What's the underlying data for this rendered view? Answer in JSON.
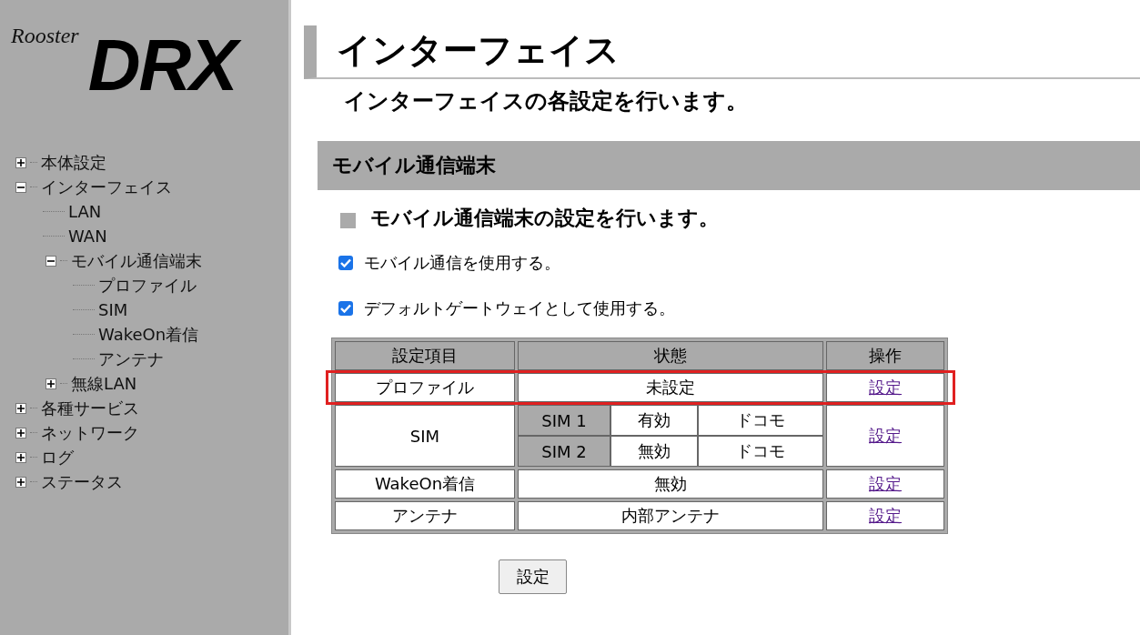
{
  "logo": {
    "small": "Rooster",
    "large": "DRX"
  },
  "sidebar": {
    "items": [
      {
        "label": "本体設定",
        "expanded": false
      },
      {
        "label": "インターフェイス",
        "expanded": true,
        "children": [
          {
            "label": "LAN"
          },
          {
            "label": "WAN"
          },
          {
            "label": "モバイル通信端末",
            "expanded": true,
            "children": [
              {
                "label": "プロファイル"
              },
              {
                "label": "SIM"
              },
              {
                "label": "WakeOn着信"
              },
              {
                "label": "アンテナ"
              }
            ]
          },
          {
            "label": "無線LAN",
            "expanded": false
          }
        ]
      },
      {
        "label": "各種サービス",
        "expanded": false
      },
      {
        "label": "ネットワーク",
        "expanded": false
      },
      {
        "label": "ログ",
        "expanded": false
      },
      {
        "label": "ステータス",
        "expanded": false
      }
    ]
  },
  "page": {
    "title": "インターフェイス",
    "subtitle": "インターフェイスの各設定を行います。"
  },
  "section": {
    "title": "モバイル通信端末",
    "description": "モバイル通信端末の設定を行います。",
    "options": [
      {
        "label": "モバイル通信を使用する。",
        "checked": true
      },
      {
        "label": "デフォルトゲートウェイとして使用する。",
        "checked": true
      }
    ]
  },
  "table": {
    "columns": [
      "設定項目",
      "状態",
      "操作"
    ],
    "rows": [
      {
        "kind": "simple",
        "item": "プロファイル",
        "status": "未設定",
        "action": "設定"
      },
      {
        "kind": "sim",
        "item": "SIM",
        "sims": [
          {
            "name": "SIM 1",
            "state": "有効",
            "carrier": "ドコモ"
          },
          {
            "name": "SIM 2",
            "state": "無効",
            "carrier": "ドコモ"
          }
        ],
        "action": "設定"
      },
      {
        "kind": "simple",
        "item": "WakeOn着信",
        "status": "無効",
        "action": "設定"
      },
      {
        "kind": "simple",
        "item": "アンテナ",
        "status": "内部アンテナ",
        "action": "設定"
      }
    ]
  },
  "submit": "設定"
}
